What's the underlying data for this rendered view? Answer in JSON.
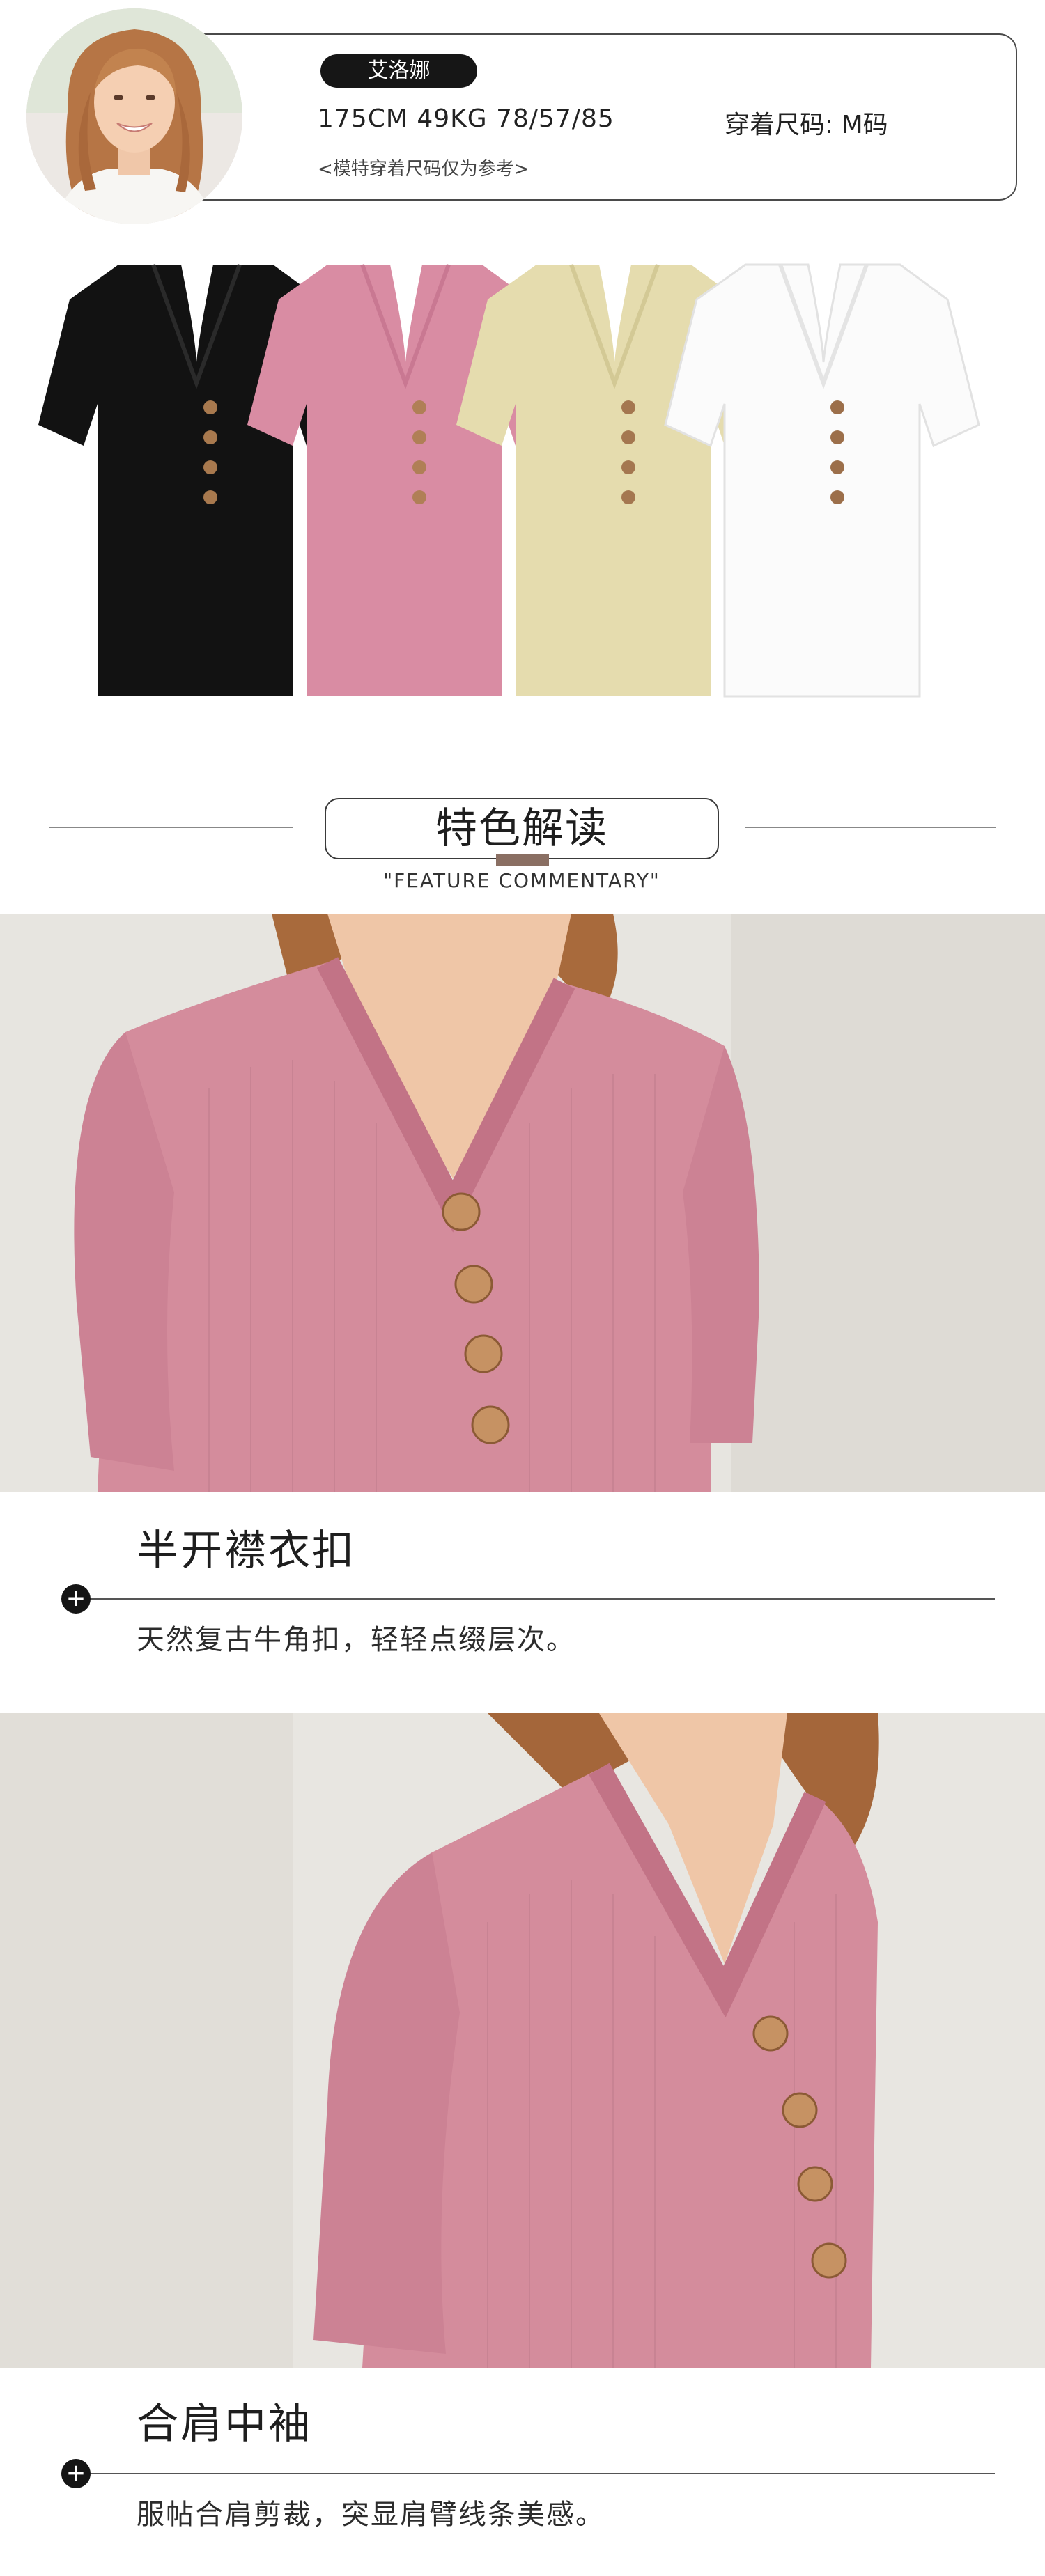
{
  "model": {
    "name": "艾洛娜",
    "stats": "175CM  49KG  78/57/85",
    "size_worn": "穿着尺码: M码",
    "note": "<模特穿着尺码仅为参考>"
  },
  "colorways": [
    {
      "color": "#121212",
      "button": "#a8794e"
    },
    {
      "color": "#d98ca3",
      "button": "#b07f56"
    },
    {
      "color": "#e5dcae",
      "button": "#a47750"
    },
    {
      "color": "#fbfbfb",
      "button": "#9c6f4a"
    }
  ],
  "section": {
    "title": "特色解读",
    "subtitle": "\"FEATURE COMMENTARY\""
  },
  "features": [
    {
      "title": "半开襟衣扣",
      "description": "天然复古牛角扣，轻轻点缀层次。"
    },
    {
      "title": "合肩中袖",
      "description": "服帖合肩剪裁，突显肩臂线条美感。"
    }
  ],
  "colors": {
    "accent": "#8a6f63",
    "knit_pink": "#d48c9c",
    "wall": "#e6e4df",
    "hair": "#b97a48"
  }
}
